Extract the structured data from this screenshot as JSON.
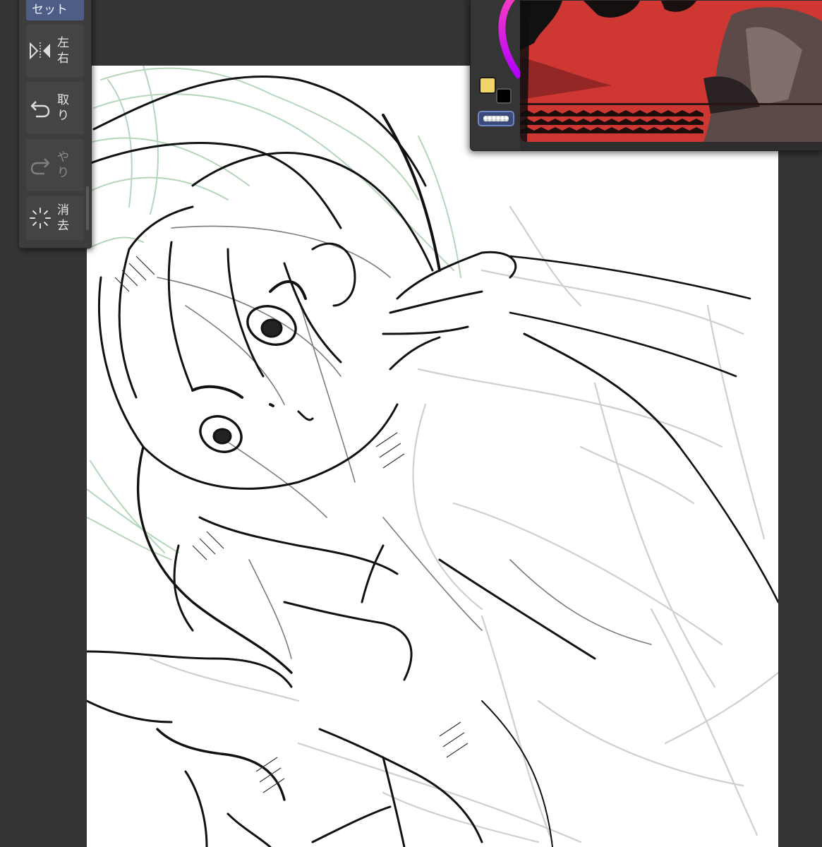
{
  "toolbar": {
    "top_label": "セット",
    "items": [
      {
        "label": "左右",
        "icon": "flip-horizontal-icon",
        "enabled": true
      },
      {
        "label": "取り",
        "icon": "undo-icon",
        "enabled": true
      },
      {
        "label": "やり",
        "icon": "redo-icon",
        "enabled": false
      },
      {
        "label": "消去",
        "icon": "clear-icon",
        "enabled": true
      }
    ]
  },
  "colors": {
    "main_color": "#f2d56a",
    "sub_color": "#000000",
    "canvas_bg": "#ffffff",
    "app_bg": "#343434",
    "ring_gradient": [
      "#ff40c0",
      "#b000ff"
    ]
  }
}
